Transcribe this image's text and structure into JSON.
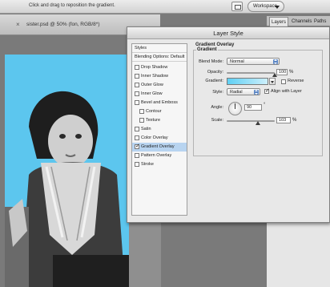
{
  "options_bar": {
    "hint": "Click and drag to reposition the gradient.",
    "workspace_label": "Workspace"
  },
  "document": {
    "close_glyph": "×",
    "title": "sister.psd @ 50% (fon, RGB/8*)"
  },
  "panel_tabs": [
    {
      "label": "Layers",
      "active": true
    },
    {
      "label": "Channels",
      "active": false
    },
    {
      "label": "Paths",
      "active": false
    }
  ],
  "dialog": {
    "title": "Layer Style",
    "style_list": {
      "header": "Styles",
      "blending_options": "Blending Options: Default",
      "items": [
        {
          "label": "Drop Shadow",
          "checked": false,
          "sub": false,
          "selected": false
        },
        {
          "label": "Inner Shadow",
          "checked": false,
          "sub": false,
          "selected": false
        },
        {
          "label": "Outer Glow",
          "checked": false,
          "sub": false,
          "selected": false
        },
        {
          "label": "Inner Glow",
          "checked": false,
          "sub": false,
          "selected": false
        },
        {
          "label": "Bevel and Emboss",
          "checked": false,
          "sub": false,
          "selected": false
        },
        {
          "label": "Contour",
          "checked": false,
          "sub": true,
          "selected": false
        },
        {
          "label": "Texture",
          "checked": false,
          "sub": true,
          "selected": false
        },
        {
          "label": "Satin",
          "checked": false,
          "sub": false,
          "selected": false
        },
        {
          "label": "Color Overlay",
          "checked": false,
          "sub": false,
          "selected": false
        },
        {
          "label": "Gradient Overlay",
          "checked": true,
          "sub": false,
          "selected": true
        },
        {
          "label": "Pattern Overlay",
          "checked": false,
          "sub": false,
          "selected": false
        },
        {
          "label": "Stroke",
          "checked": false,
          "sub": false,
          "selected": false
        }
      ]
    },
    "gradient_overlay": {
      "section_title": "Gradient Overlay",
      "group_title": "Gradient",
      "blend_mode": {
        "label": "Blend Mode:",
        "value": "Normal"
      },
      "opacity": {
        "label": "Opacity:",
        "value": "100",
        "unit": "%",
        "fraction": 1.0
      },
      "gradient": {
        "label": "Gradient:",
        "reverse_label": "Reverse",
        "reverse_checked": false,
        "colors": [
          "#5fd0f4",
          "#cdeffc"
        ]
      },
      "style": {
        "label": "Style:",
        "value": "Radial",
        "align_label": "Align with Layer",
        "align_checked": true
      },
      "angle": {
        "label": "Angle:",
        "value": "90",
        "unit": "°"
      },
      "scale": {
        "label": "Scale:",
        "value": "103",
        "unit": "%"
      }
    }
  }
}
